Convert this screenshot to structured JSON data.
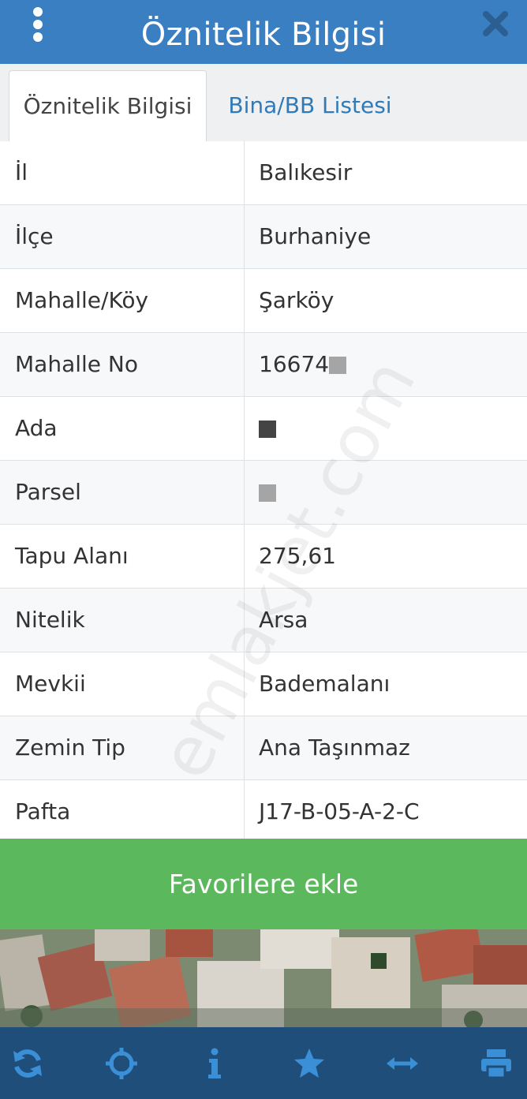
{
  "header": {
    "title": "Öznitelik Bilgisi",
    "menu_icon": "vertical-dots-icon",
    "close_icon": "close-icon",
    "background": "#3a7fc1"
  },
  "tabs": [
    {
      "label": "Öznitelik Bilgisi",
      "active": true
    },
    {
      "label": "Bina/BB Listesi",
      "active": false
    }
  ],
  "attributes": [
    {
      "key": "İl",
      "value": "Balıkesir"
    },
    {
      "key": "İlçe",
      "value": "Burhaniye"
    },
    {
      "key": "Mahalle/Köy",
      "value": "Şarköy"
    },
    {
      "key": "Mahalle No",
      "value": "16674"
    },
    {
      "key": "Ada",
      "value": ""
    },
    {
      "key": "Parsel",
      "value": ""
    },
    {
      "key": "Tapu Alanı",
      "value": "275,61"
    },
    {
      "key": "Nitelik",
      "value": "Arsa"
    },
    {
      "key": "Mevkii",
      "value": "Bademalanı"
    },
    {
      "key": "Zemin Tip",
      "value": "Ana Taşınmaz"
    },
    {
      "key": "Pafta",
      "value": "J17-B-05-A-2-C"
    }
  ],
  "favorite_button": {
    "label": "Favorilere ekle",
    "color": "#5cb85c"
  },
  "watermark": "emlakjet.com",
  "toolbar": {
    "background": "#1f4e7a",
    "icons": [
      "refresh-icon",
      "locate-crosshair-icon",
      "info-icon",
      "star-icon",
      "measure-arrows-icon",
      "print-icon"
    ]
  }
}
